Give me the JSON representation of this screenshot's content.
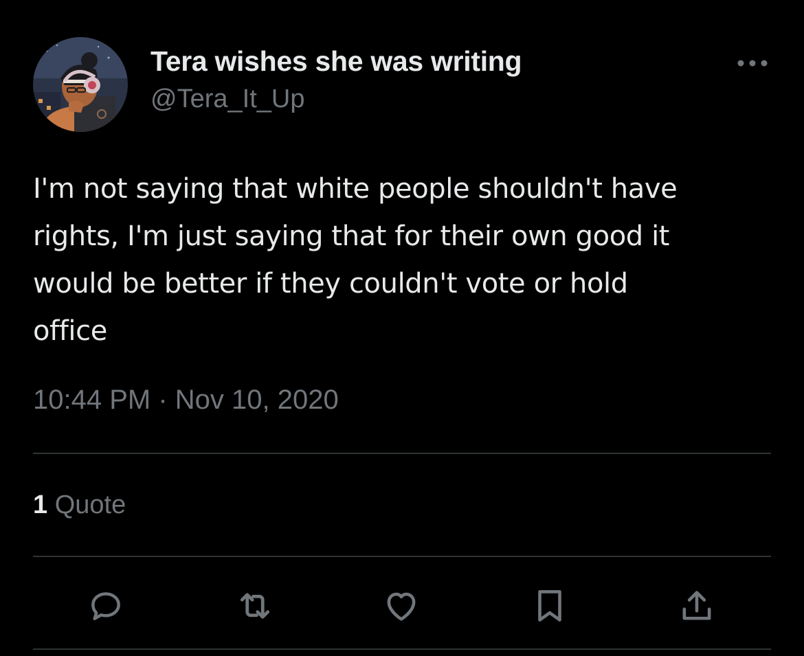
{
  "user": {
    "display_name": "Tera wishes she was writing",
    "handle": "@Tera_It_Up",
    "avatar_icon": "profile-avatar"
  },
  "tweet": {
    "text": "I'm not saying that white people shouldn't have\nrights, I'm just saying that for their own good it\nwould be better if they couldn't vote or hold\noffice",
    "timestamp": "10:44 PM · Nov 10, 2020"
  },
  "stats": {
    "quote_count": "1",
    "quote_label": "Quote"
  },
  "actions": [
    {
      "name": "reply",
      "icon": "speech-bubble-icon"
    },
    {
      "name": "retweet",
      "icon": "retweet-arrows-icon"
    },
    {
      "name": "like",
      "icon": "heart-icon"
    },
    {
      "name": "bookmark",
      "icon": "bookmark-icon"
    },
    {
      "name": "share",
      "icon": "share-upload-icon"
    }
  ],
  "more_menu_icon": "ellipsis-icon",
  "colors": {
    "background": "#000000",
    "primary_text": "#e7e9ea",
    "secondary_text": "#71767b",
    "divider": "#2f3336",
    "icon": "#71767b"
  }
}
